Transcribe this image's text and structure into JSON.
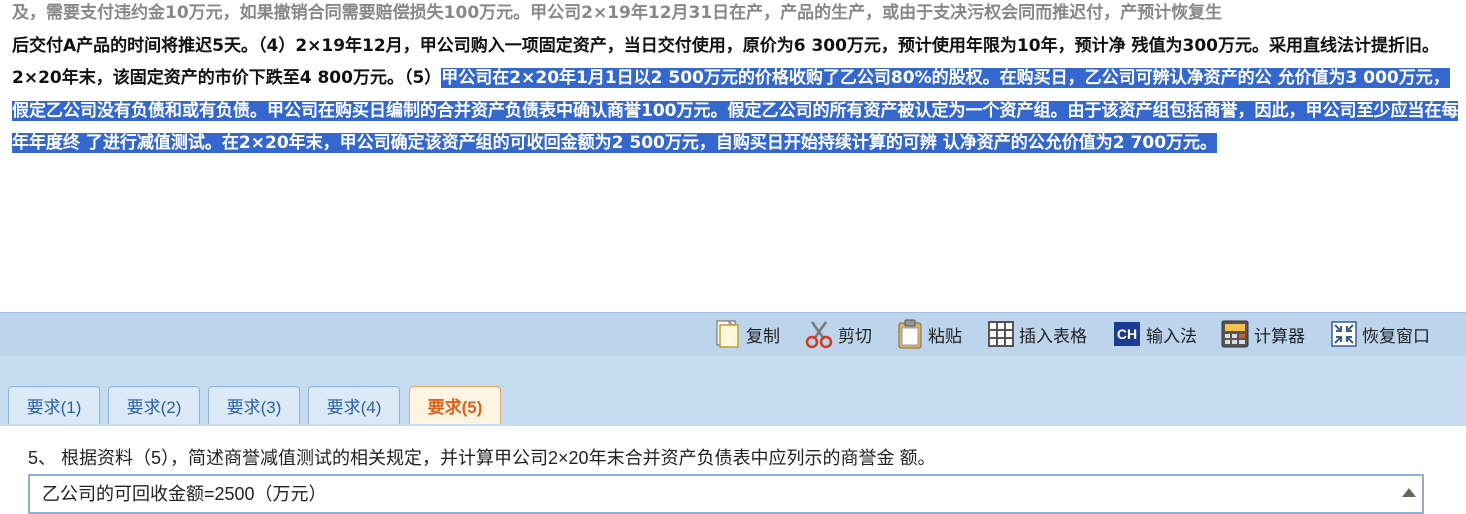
{
  "passage": {
    "line_partial": "及，需要支付违约金10万元，如果撤销合同需要赔偿损失100万元。甲公司2×19年12月31日在产，产品的生产，或由于支决污权会同而推迟付，产预计恢复生",
    "plain": "后交付A产品的时间将推迟5天。（4）2×19年12月，甲公司购入一项固定资产，当日交付使用，原价为6 300万元，预计使用年限为10年，预计净 残值为300万元。采用直线法计提折旧。2×20年末，该固定资产的市价下跌至4 800万元。（5）",
    "highlighted": "甲公司在2×20年1月1日以2 500万元的价格收购了乙公司80%的股权。在购买日，乙公司可辨认净资产的公 允价值为3 000万元，假定乙公司没有负债和或有负债。甲公司在购买日编制的合并资产负债表中确认商誉100万元。假定乙公司的所有资产被认定为一个资产组。由于该资产组包括商誉，因此，甲公司至少应当在每年年度终 了进行减值测试。在2×20年末，甲公司确定该资产组的可收回金额为2 500万元，自购买日开始持续计算的可辨 认净资产的公允价值为2 700万元。",
    "highlight_color": "#3568cf"
  },
  "toolbar": {
    "copy": "复制",
    "cut": "剪切",
    "paste": "粘贴",
    "insert_table": "插入表格",
    "ime": "输入法",
    "ime_badge": "CH",
    "calculator": "计算器",
    "restore": "恢复窗口"
  },
  "tabs": [
    "要求(1)",
    "要求(2)",
    "要求(3)",
    "要求(4)",
    "要求(5)"
  ],
  "active_tab_index": 4,
  "question": {
    "text": "5、 根据资料（5），简述商誉减值测试的相关规定，并计算甲公司2×20年末合并资产负债表中应列示的商誉金 额。"
  },
  "answer": {
    "value": "乙公司的可回收金额=2500（万元）"
  }
}
